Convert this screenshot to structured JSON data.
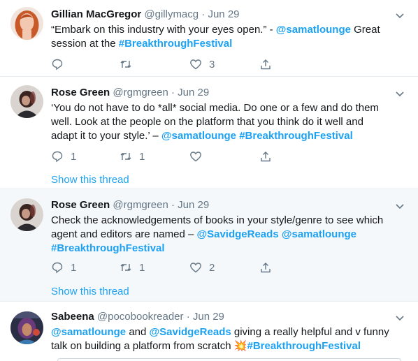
{
  "tweets": [
    {
      "name": "Gillian MacGregor",
      "handle": "@gillymacg",
      "dot": "·",
      "date": "Jun 29",
      "text": {
        "p1": "“Embark on this industry with your eyes open.” - ",
        "m1": "@samatlounge",
        "p2": " Great",
        "p3": "session at the ",
        "h1": "#BreakthroughFestival"
      },
      "replies": "",
      "retweets": "",
      "likes": "3"
    },
    {
      "name": "Rose Green",
      "handle": "@rgmgreen",
      "dot": "·",
      "date": "Jun 29",
      "text": {
        "l1": "‘You do not have to do *all* social media. Do one or a few and do them",
        "l2": "well. Look at the people on the platform that you think do it well and",
        "l3": "adapt it to your style.’ – ",
        "m1": "@samatlounge",
        "h1": "#BreakthroughFestival"
      },
      "replies": "1",
      "retweets": "1",
      "likes": "",
      "show_thread": "Show this thread"
    },
    {
      "name": "Rose Green",
      "handle": "@rgmgreen",
      "dot": "·",
      "date": "Jun 29",
      "text": {
        "l1": "Check the acknowledgements of books in your style/genre to see which",
        "l2": "agent and editors are named – ",
        "m1": "@SavidgeReads",
        "m2": "@samatlounge",
        "h1": "#BreakthroughFestival"
      },
      "replies": "1",
      "retweets": "1",
      "likes": "2",
      "show_thread": "Show this thread"
    },
    {
      "name": "Sabeena",
      "handle": "@pocobookreader",
      "dot": "·",
      "date": "Jun 29",
      "text": {
        "m1": "@samatlounge",
        "p1": " and ",
        "m2": "@SavidgeReads",
        "p2": " giving a really helpful and v funny",
        "p3": "talk on building a platform from scratch ",
        "emoji": "💥",
        "h1": "#BreakthroughFestival"
      }
    }
  ],
  "colors": {
    "link": "#1da1f2",
    "muted": "#657786",
    "highlight_bg": "#f5f8fa"
  }
}
